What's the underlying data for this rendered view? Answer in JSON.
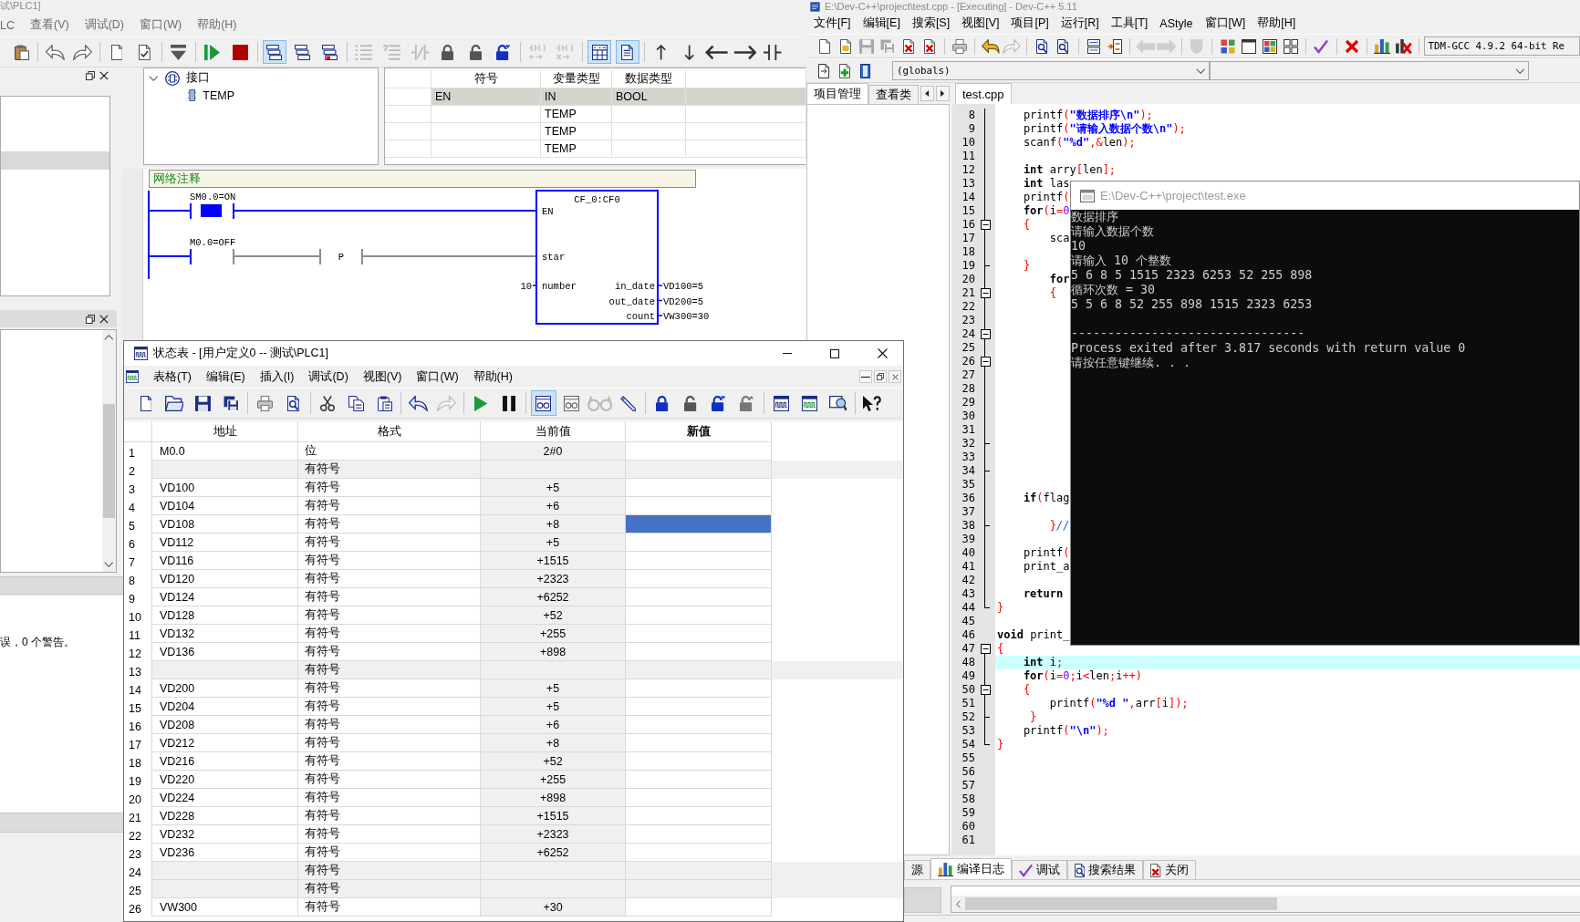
{
  "plc_window": {
    "title": "试\\PLC1]",
    "menu": [
      "LC",
      "查看(V)",
      "调试(D)",
      "窗口(W)",
      "帮助(H)"
    ],
    "toolbar": [
      {
        "pressed": false,
        "disabled": false
      },
      {
        "pressed": false,
        "disabled": false
      },
      {
        "pressed": false,
        "disabled": false
      },
      {
        "pressed": false,
        "disabled": false
      },
      {
        "pressed": false,
        "disabled": false
      },
      {
        "pressed": false,
        "disabled": false
      },
      {
        "pressed": false,
        "disabled": false
      },
      {
        "pressed": false,
        "disabled": false
      },
      {
        "pressed": true,
        "disabled": false
      },
      {
        "pressed": false,
        "disabled": false
      },
      {
        "pressed": false,
        "disabled": false
      },
      {
        "pressed": false,
        "disabled": true
      },
      {
        "pressed": false,
        "disabled": true
      },
      {
        "pressed": false,
        "disabled": true
      },
      {
        "pressed": false,
        "disabled": false
      },
      {
        "pressed": false,
        "disabled": false
      },
      {
        "pressed": false,
        "disabled": false
      },
      {
        "pressed": false,
        "disabled": true
      },
      {
        "pressed": false,
        "disabled": true
      },
      {
        "pressed": true,
        "disabled": false
      },
      {
        "pressed": true,
        "disabled": false
      },
      {
        "pressed": false,
        "disabled": false
      },
      {
        "pressed": false,
        "disabled": false
      },
      {
        "pressed": false,
        "disabled": false
      },
      {
        "pressed": false,
        "disabled": false
      },
      {
        "pressed": false,
        "disabled": false
      }
    ],
    "project_panel": {
      "items": [
        {
          "selected": false
        },
        {
          "selected": false
        },
        {
          "selected": false
        },
        {
          "selected": true
        }
      ]
    },
    "output_panel": {
      "message": "误，0 个警告。"
    },
    "interface_tree": {
      "label": "接口",
      "expanded": true,
      "children": [
        {
          "label": "TEMP"
        }
      ]
    },
    "variable_table": {
      "columns": [
        "符号",
        "变量类型",
        "数据类型"
      ],
      "rows": [
        {
          "symbol": "EN",
          "variable_type": "IN",
          "data_type": "BOOL",
          "readonly": true
        },
        {
          "variable_type": "TEMP",
          "readonly": false
        },
        {
          "variable_type": "TEMP",
          "readonly": false
        },
        {
          "variable_type": "TEMP",
          "readonly": false
        }
      ]
    },
    "ladder": {
      "comment": "网络注释",
      "contacts": [
        {
          "label": "SM0.0=ON",
          "on": true
        },
        {
          "label": "M0.0=OFF",
          "on": false
        }
      ],
      "edge": "P",
      "block": {
        "title": "CF_0:CF0",
        "inputs": [
          {
            "pin": "EN"
          },
          {
            "pin": "star"
          },
          {
            "pin": "number",
            "value": "10"
          }
        ],
        "outputs": [
          {
            "pin": "in_date",
            "value": "VD100=5"
          },
          {
            "pin": "out_date",
            "value": "VD200=5"
          },
          {
            "pin": "count",
            "value": "VW300=30"
          }
        ]
      }
    }
  },
  "devcpp_window": {
    "title": "E:\\Dev-C++\\project\\test.cpp - [Executing] - Dev-C++ 5.11",
    "menu": [
      "文件[F]",
      "编辑[E]",
      "搜索[S]",
      "视图[V]",
      "项目[P]",
      "运行[R]",
      "工具[T]",
      "AStyle",
      "窗口[W]",
      "帮助[H]"
    ],
    "toolbar": [
      {
        "disabled": false
      },
      {
        "disabled": false
      },
      {
        "disabled": true
      },
      {
        "disabled": true
      },
      {
        "disabled": false
      },
      {
        "disabled": false
      },
      {
        "disabled": false
      },
      {
        "disabled": false
      },
      {
        "disabled": true
      },
      {
        "disabled": false
      },
      {
        "disabled": false
      },
      {
        "disabled": false
      },
      {
        "disabled": false
      },
      {
        "disabled": true
      },
      {
        "disabled": true
      },
      {
        "disabled": true
      },
      {
        "disabled": false
      },
      {
        "disabled": false
      },
      {
        "disabled": false
      },
      {
        "disabled": false
      },
      {
        "disabled": false
      },
      {
        "disabled": false
      },
      {
        "disabled": false
      },
      {
        "disabled": false
      }
    ],
    "compiler": "TDM-GCC 4.9.2 64-bit Re",
    "scope": "(globals)",
    "side_tabs": [
      {
        "label": "项目管理",
        "selected": true
      },
      {
        "label": "查看类",
        "selected": false
      }
    ],
    "editor_tabs": [
      {
        "label": "test.cpp",
        "selected": true
      }
    ],
    "lines": [
      {
        "number": "8",
        "kind": "guide",
        "highlighted": false,
        "code": [
          {
            "text": "    printf",
            "kind": "plain"
          },
          {
            "text": "(",
            "kind": "symbol"
          },
          {
            "text": "\"数据排序\\n\"",
            "kind": "string"
          },
          {
            "text": ");",
            "kind": "symbol"
          }
        ]
      },
      {
        "number": "9",
        "kind": "guide",
        "highlighted": false,
        "code": [
          {
            "text": "    printf",
            "kind": "plain"
          },
          {
            "text": "(",
            "kind": "symbol"
          },
          {
            "text": "\"请输入数据个数\\n\"",
            "kind": "string"
          },
          {
            "text": ");",
            "kind": "symbol"
          }
        ]
      },
      {
        "number": "10",
        "kind": "guide",
        "highlighted": false,
        "code": [
          {
            "text": "    scanf",
            "kind": "plain"
          },
          {
            "text": "(",
            "kind": "symbol"
          },
          {
            "text": "\"%d\"",
            "kind": "string"
          },
          {
            "text": ",&",
            "kind": "symbol"
          },
          {
            "text": "len",
            "kind": "plain"
          },
          {
            "text": ");",
            "kind": "symbol"
          }
        ]
      },
      {
        "number": "11",
        "kind": "guide",
        "highlighted": false
      },
      {
        "number": "12",
        "kind": "guide",
        "highlighted": false,
        "code": [
          {
            "text": "    int",
            "kind": "keyword"
          },
          {
            "text": " arry",
            "kind": "plain"
          },
          {
            "text": "[",
            "kind": "symbol"
          },
          {
            "text": "len",
            "kind": "plain"
          },
          {
            "text": "];",
            "kind": "symbol"
          }
        ]
      },
      {
        "number": "13",
        "kind": "guide",
        "highlighted": false,
        "code": [
          {
            "text": "    int",
            "kind": "keyword"
          },
          {
            "text": " las",
            "kind": "plain"
          }
        ]
      },
      {
        "number": "14",
        "kind": "guide",
        "highlighted": false,
        "code": [
          {
            "text": "    printf",
            "kind": "plain"
          },
          {
            "text": "(",
            "kind": "symbol"
          }
        ]
      },
      {
        "number": "15",
        "kind": "guide",
        "highlighted": false,
        "code": [
          {
            "text": "    for",
            "kind": "keyword"
          },
          {
            "text": "(",
            "kind": "symbol"
          },
          {
            "text": "i",
            "kind": "plain"
          },
          {
            "text": "=",
            "kind": "symbol"
          },
          {
            "text": "0",
            "kind": "number"
          }
        ]
      },
      {
        "number": "16",
        "kind": "fold",
        "highlighted": false,
        "code": [
          {
            "text": "    {",
            "kind": "symbol"
          }
        ]
      },
      {
        "number": "17",
        "kind": "guide",
        "highlighted": false,
        "code": [
          {
            "text": "        sca",
            "kind": "plain"
          }
        ]
      },
      {
        "number": "18",
        "kind": "guide",
        "highlighted": false
      },
      {
        "number": "19",
        "kind": "branch",
        "highlighted": false,
        "code": [
          {
            "text": "    }",
            "kind": "symbol"
          }
        ]
      },
      {
        "number": "20",
        "kind": "guide",
        "highlighted": false,
        "code": [
          {
            "text": "        for",
            "kind": "keyword"
          }
        ]
      },
      {
        "number": "21",
        "kind": "fold",
        "highlighted": false,
        "code": [
          {
            "text": "        {",
            "kind": "symbol"
          }
        ]
      },
      {
        "number": "22",
        "kind": "guide",
        "highlighted": false
      },
      {
        "number": "23",
        "kind": "guide",
        "highlighted": false
      },
      {
        "number": "24",
        "kind": "fold",
        "highlighted": false
      },
      {
        "number": "25",
        "kind": "guide",
        "highlighted": false
      },
      {
        "number": "26",
        "kind": "fold",
        "highlighted": false
      },
      {
        "number": "27",
        "kind": "guide",
        "highlighted": false
      },
      {
        "number": "28",
        "kind": "guide",
        "highlighted": false
      },
      {
        "number": "29",
        "kind": "guide",
        "highlighted": false
      },
      {
        "number": "30",
        "kind": "guide",
        "highlighted": false
      },
      {
        "number": "31",
        "kind": "guide",
        "highlighted": false
      },
      {
        "number": "32",
        "kind": "branch",
        "highlighted": false
      },
      {
        "number": "33",
        "kind": "guide",
        "highlighted": false
      },
      {
        "number": "34",
        "kind": "branch",
        "highlighted": false
      },
      {
        "number": "35",
        "kind": "guide",
        "highlighted": false
      },
      {
        "number": "36",
        "kind": "guide",
        "highlighted": false,
        "code": [
          {
            "text": "    if",
            "kind": "keyword"
          },
          {
            "text": "(",
            "kind": "symbol"
          },
          {
            "text": "flag",
            "kind": "plain"
          }
        ]
      },
      {
        "number": "37",
        "kind": "guide",
        "highlighted": false
      },
      {
        "number": "38",
        "kind": "branch",
        "highlighted": false,
        "code": [
          {
            "text": "        }",
            "kind": "symbol"
          },
          {
            "text": "//",
            "kind": "comment"
          }
        ]
      },
      {
        "number": "39",
        "kind": "guide",
        "highlighted": false
      },
      {
        "number": "40",
        "kind": "guide",
        "highlighted": false,
        "code": [
          {
            "text": "    printf",
            "kind": "plain"
          },
          {
            "text": "(",
            "kind": "symbol"
          }
        ]
      },
      {
        "number": "41",
        "kind": "guide",
        "highlighted": false,
        "code": [
          {
            "text": "    print_a",
            "kind": "plain"
          }
        ]
      },
      {
        "number": "42",
        "kind": "guide",
        "highlighted": false
      },
      {
        "number": "43",
        "kind": "guide",
        "highlighted": false,
        "code": [
          {
            "text": "    return",
            "kind": "keyword"
          }
        ]
      },
      {
        "number": "44",
        "kind": "end",
        "highlighted": false,
        "code": [
          {
            "text": "}",
            "kind": "symbol"
          }
        ]
      },
      {
        "number": "45",
        "kind": "plain",
        "highlighted": false
      },
      {
        "number": "46",
        "kind": "plain",
        "highlighted": false,
        "code": [
          {
            "text": "void",
            "kind": "keyword"
          },
          {
            "text": " print_",
            "kind": "plain"
          }
        ]
      },
      {
        "number": "47",
        "kind": "fold",
        "highlighted": false,
        "code": [
          {
            "text": "{",
            "kind": "symbol"
          }
        ]
      },
      {
        "number": "48",
        "kind": "guide",
        "highlighted": true,
        "code": [
          {
            "text": "    int",
            "kind": "keyword"
          },
          {
            "text": " i",
            "kind": "plain"
          },
          {
            "text": ";",
            "kind": "symbol"
          }
        ]
      },
      {
        "number": "49",
        "kind": "guide",
        "highlighted": false,
        "code": [
          {
            "text": "    for",
            "kind": "keyword"
          },
          {
            "text": "(",
            "kind": "symbol"
          },
          {
            "text": "i",
            "kind": "plain"
          },
          {
            "text": "=",
            "kind": "symbol"
          },
          {
            "text": "0",
            "kind": "number"
          },
          {
            "text": ";",
            "kind": "symbol"
          },
          {
            "text": "i",
            "kind": "plain"
          },
          {
            "text": "<",
            "kind": "symbol"
          },
          {
            "text": "len",
            "kind": "plain"
          },
          {
            "text": ";",
            "kind": "symbol"
          },
          {
            "text": "i",
            "kind": "plain"
          },
          {
            "text": "++)",
            "kind": "symbol"
          }
        ]
      },
      {
        "number": "50",
        "kind": "fold",
        "highlighted": false,
        "code": [
          {
            "text": "    {",
            "kind": "symbol"
          }
        ]
      },
      {
        "number": "51",
        "kind": "guide",
        "highlighted": false,
        "code": [
          {
            "text": "        printf",
            "kind": "plain"
          },
          {
            "text": "(",
            "kind": "symbol"
          },
          {
            "text": "\"%d \"",
            "kind": "string"
          },
          {
            "text": ",",
            "kind": "symbol"
          },
          {
            "text": "arr",
            "kind": "plain"
          },
          {
            "text": "[",
            "kind": "symbol"
          },
          {
            "text": "i",
            "kind": "plain"
          },
          {
            "text": "]);",
            "kind": "symbol"
          }
        ]
      },
      {
        "number": "52",
        "kind": "branch",
        "highlighted": false,
        "code": [
          {
            "text": "     }",
            "kind": "symbol"
          }
        ]
      },
      {
        "number": "53",
        "kind": "guide",
        "highlighted": false,
        "code": [
          {
            "text": "    printf",
            "kind": "plain"
          },
          {
            "text": "(",
            "kind": "symbol"
          },
          {
            "text": "\"\\n\"",
            "kind": "string"
          },
          {
            "text": ");",
            "kind": "symbol"
          }
        ]
      },
      {
        "number": "54",
        "kind": "end",
        "highlighted": false,
        "code": [
          {
            "text": "}",
            "kind": "symbol"
          }
        ]
      },
      {
        "number": "55",
        "kind": "plain",
        "highlighted": false
      },
      {
        "number": "56",
        "kind": "plain",
        "highlighted": false
      },
      {
        "number": "57",
        "kind": "plain",
        "highlighted": false
      },
      {
        "number": "58",
        "kind": "plain",
        "highlighted": false
      },
      {
        "number": "59",
        "kind": "plain",
        "highlighted": false
      },
      {
        "number": "60",
        "kind": "plain",
        "highlighted": false
      },
      {
        "number": "61",
        "kind": "plain",
        "highlighted": false
      }
    ],
    "bottom_tabs": [
      {
        "label": "源",
        "selected": false
      },
      {
        "label": "编译日志",
        "selected": true
      },
      {
        "label": "调试",
        "selected": false
      },
      {
        "label": "搜索结果",
        "selected": false
      },
      {
        "label": "关闭",
        "selected": false
      }
    ]
  },
  "console_window": {
    "title": "E:\\Dev-C++\\project\\test.exe",
    "output": [
      "数据排序",
      "请输入数据个数",
      "10",
      "请输入 10 个整数",
      "5 6 8 5 1515 2323 6253 52 255 898",
      "循环次数 = 30",
      "5 5 6 8 52 255 898 1515 2323 6253"
    ],
    "exit_message": [
      "--------------------------------",
      "Process exited after 3.817 seconds with return value 0",
      "请按任意键继续. . ."
    ]
  },
  "status_table_window": {
    "title": "状态表 - [用户定义0 -- 测试\\PLC1]",
    "menu": [
      "表格(T)",
      "编辑(E)",
      "插入(I)",
      "调试(D)",
      "视图(V)",
      "窗口(W)",
      "帮助(H)"
    ],
    "toolbar": [
      {
        "pressed": false,
        "disabled": false
      },
      {
        "pressed": false,
        "disabled": false
      },
      {
        "pressed": false,
        "disabled": false
      },
      {
        "pressed": false,
        "disabled": false
      },
      {
        "pressed": false,
        "disabled": false
      },
      {
        "pressed": false,
        "disabled": false
      },
      {
        "pressed": false,
        "disabled": false
      },
      {
        "pressed": false,
        "disabled": false
      },
      {
        "pressed": false,
        "disabled": false
      },
      {
        "pressed": false,
        "disabled": false
      },
      {
        "pressed": false,
        "disabled": true
      },
      {
        "pressed": false,
        "disabled": false
      },
      {
        "pressed": false,
        "disabled": false
      },
      {
        "pressed": true,
        "disabled": false
      },
      {
        "pressed": false,
        "disabled": false
      },
      {
        "pressed": false,
        "disabled": true
      },
      {
        "pressed": false,
        "disabled": false
      },
      {
        "pressed": false,
        "disabled": false
      },
      {
        "pressed": false,
        "disabled": false
      },
      {
        "pressed": false,
        "disabled": false
      },
      {
        "pressed": false,
        "disabled": false
      },
      {
        "pressed": false,
        "disabled": false
      },
      {
        "pressed": false,
        "disabled": false
      },
      {
        "pressed": false,
        "disabled": false
      },
      {
        "pressed": false,
        "disabled": false
      }
    ],
    "columns": [
      {
        "label": "地址",
        "bold": false
      },
      {
        "label": "格式",
        "bold": false
      },
      {
        "label": "当前值",
        "bold": false
      },
      {
        "label": "新值",
        "bold": true
      }
    ],
    "rows": [
      {
        "number": "1",
        "address": "M0.0",
        "format": "位",
        "current": "2#0",
        "inactive": false,
        "selected": false
      },
      {
        "number": "2",
        "format": "有符号",
        "inactive": true,
        "selected": false
      },
      {
        "number": "3",
        "address": "VD100",
        "format": "有符号",
        "current": "+5",
        "inactive": false,
        "selected": false
      },
      {
        "number": "4",
        "address": "VD104",
        "format": "有符号",
        "current": "+6",
        "inactive": false,
        "selected": false
      },
      {
        "number": "5",
        "address": "VD108",
        "format": "有符号",
        "current": "+8",
        "inactive": false,
        "selected": true
      },
      {
        "number": "6",
        "address": "VD112",
        "format": "有符号",
        "current": "+5",
        "inactive": false,
        "selected": false
      },
      {
        "number": "7",
        "address": "VD116",
        "format": "有符号",
        "current": "+1515",
        "inactive": false,
        "selected": false
      },
      {
        "number": "8",
        "address": "VD120",
        "format": "有符号",
        "current": "+2323",
        "inactive": false,
        "selected": false
      },
      {
        "number": "9",
        "address": "VD124",
        "format": "有符号",
        "current": "+6252",
        "inactive": false,
        "selected": false
      },
      {
        "number": "10",
        "address": "VD128",
        "format": "有符号",
        "current": "+52",
        "inactive": false,
        "selected": false
      },
      {
        "number": "11",
        "address": "VD132",
        "format": "有符号",
        "current": "+255",
        "inactive": false,
        "selected": false
      },
      {
        "number": "12",
        "address": "VD136",
        "format": "有符号",
        "current": "+898",
        "inactive": false,
        "selected": false
      },
      {
        "number": "13",
        "format": "有符号",
        "inactive": true,
        "selected": false
      },
      {
        "number": "14",
        "address": "VD200",
        "format": "有符号",
        "current": "+5",
        "inactive": false,
        "selected": false
      },
      {
        "number": "15",
        "address": "VD204",
        "format": "有符号",
        "current": "+5",
        "inactive": false,
        "selected": false
      },
      {
        "number": "16",
        "address": "VD208",
        "format": "有符号",
        "current": "+6",
        "inactive": false,
        "selected": false
      },
      {
        "number": "17",
        "address": "VD212",
        "format": "有符号",
        "current": "+8",
        "inactive": false,
        "selected": false
      },
      {
        "number": "18",
        "address": "VD216",
        "format": "有符号",
        "current": "+52",
        "inactive": false,
        "selected": false
      },
      {
        "number": "19",
        "address": "VD220",
        "format": "有符号",
        "current": "+255",
        "inactive": false,
        "selected": false
      },
      {
        "number": "20",
        "address": "VD224",
        "format": "有符号",
        "current": "+898",
        "inactive": false,
        "selected": false
      },
      {
        "number": "21",
        "address": "VD228",
        "format": "有符号",
        "current": "+1515",
        "inactive": false,
        "selected": false
      },
      {
        "number": "22",
        "address": "VD232",
        "format": "有符号",
        "current": "+2323",
        "inactive": false,
        "selected": false
      },
      {
        "number": "23",
        "address": "VD236",
        "format": "有符号",
        "current": "+6252",
        "inactive": false,
        "selected": false
      },
      {
        "number": "24",
        "format": "有符号",
        "inactive": true,
        "selected": false
      },
      {
        "number": "25",
        "format": "有符号",
        "inactive": true,
        "selected": false
      },
      {
        "number": "26",
        "address": "VW300",
        "format": "有符号",
        "current": "+30",
        "inactive": false,
        "selected": false
      }
    ]
  }
}
